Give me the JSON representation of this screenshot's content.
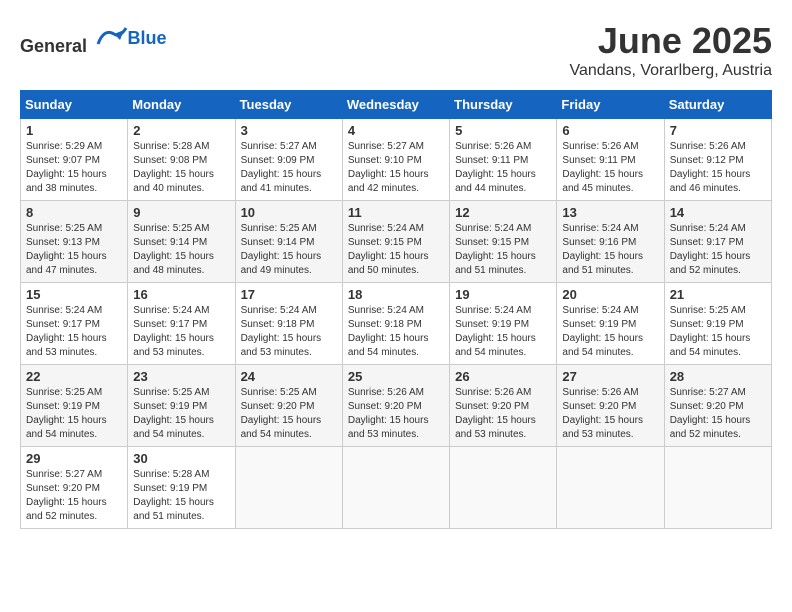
{
  "header": {
    "logo_general": "General",
    "logo_blue": "Blue",
    "month": "June 2025",
    "location": "Vandans, Vorarlberg, Austria"
  },
  "weekdays": [
    "Sunday",
    "Monday",
    "Tuesday",
    "Wednesday",
    "Thursday",
    "Friday",
    "Saturday"
  ],
  "weeks": [
    [
      {
        "day": "1",
        "sunrise": "Sunrise: 5:29 AM",
        "sunset": "Sunset: 9:07 PM",
        "daylight": "Daylight: 15 hours and 38 minutes."
      },
      {
        "day": "2",
        "sunrise": "Sunrise: 5:28 AM",
        "sunset": "Sunset: 9:08 PM",
        "daylight": "Daylight: 15 hours and 40 minutes."
      },
      {
        "day": "3",
        "sunrise": "Sunrise: 5:27 AM",
        "sunset": "Sunset: 9:09 PM",
        "daylight": "Daylight: 15 hours and 41 minutes."
      },
      {
        "day": "4",
        "sunrise": "Sunrise: 5:27 AM",
        "sunset": "Sunset: 9:10 PM",
        "daylight": "Daylight: 15 hours and 42 minutes."
      },
      {
        "day": "5",
        "sunrise": "Sunrise: 5:26 AM",
        "sunset": "Sunset: 9:11 PM",
        "daylight": "Daylight: 15 hours and 44 minutes."
      },
      {
        "day": "6",
        "sunrise": "Sunrise: 5:26 AM",
        "sunset": "Sunset: 9:11 PM",
        "daylight": "Daylight: 15 hours and 45 minutes."
      },
      {
        "day": "7",
        "sunrise": "Sunrise: 5:26 AM",
        "sunset": "Sunset: 9:12 PM",
        "daylight": "Daylight: 15 hours and 46 minutes."
      }
    ],
    [
      {
        "day": "8",
        "sunrise": "Sunrise: 5:25 AM",
        "sunset": "Sunset: 9:13 PM",
        "daylight": "Daylight: 15 hours and 47 minutes."
      },
      {
        "day": "9",
        "sunrise": "Sunrise: 5:25 AM",
        "sunset": "Sunset: 9:14 PM",
        "daylight": "Daylight: 15 hours and 48 minutes."
      },
      {
        "day": "10",
        "sunrise": "Sunrise: 5:25 AM",
        "sunset": "Sunset: 9:14 PM",
        "daylight": "Daylight: 15 hours and 49 minutes."
      },
      {
        "day": "11",
        "sunrise": "Sunrise: 5:24 AM",
        "sunset": "Sunset: 9:15 PM",
        "daylight": "Daylight: 15 hours and 50 minutes."
      },
      {
        "day": "12",
        "sunrise": "Sunrise: 5:24 AM",
        "sunset": "Sunset: 9:15 PM",
        "daylight": "Daylight: 15 hours and 51 minutes."
      },
      {
        "day": "13",
        "sunrise": "Sunrise: 5:24 AM",
        "sunset": "Sunset: 9:16 PM",
        "daylight": "Daylight: 15 hours and 51 minutes."
      },
      {
        "day": "14",
        "sunrise": "Sunrise: 5:24 AM",
        "sunset": "Sunset: 9:17 PM",
        "daylight": "Daylight: 15 hours and 52 minutes."
      }
    ],
    [
      {
        "day": "15",
        "sunrise": "Sunrise: 5:24 AM",
        "sunset": "Sunset: 9:17 PM",
        "daylight": "Daylight: 15 hours and 53 minutes."
      },
      {
        "day": "16",
        "sunrise": "Sunrise: 5:24 AM",
        "sunset": "Sunset: 9:17 PM",
        "daylight": "Daylight: 15 hours and 53 minutes."
      },
      {
        "day": "17",
        "sunrise": "Sunrise: 5:24 AM",
        "sunset": "Sunset: 9:18 PM",
        "daylight": "Daylight: 15 hours and 53 minutes."
      },
      {
        "day": "18",
        "sunrise": "Sunrise: 5:24 AM",
        "sunset": "Sunset: 9:18 PM",
        "daylight": "Daylight: 15 hours and 54 minutes."
      },
      {
        "day": "19",
        "sunrise": "Sunrise: 5:24 AM",
        "sunset": "Sunset: 9:19 PM",
        "daylight": "Daylight: 15 hours and 54 minutes."
      },
      {
        "day": "20",
        "sunrise": "Sunrise: 5:24 AM",
        "sunset": "Sunset: 9:19 PM",
        "daylight": "Daylight: 15 hours and 54 minutes."
      },
      {
        "day": "21",
        "sunrise": "Sunrise: 5:25 AM",
        "sunset": "Sunset: 9:19 PM",
        "daylight": "Daylight: 15 hours and 54 minutes."
      }
    ],
    [
      {
        "day": "22",
        "sunrise": "Sunrise: 5:25 AM",
        "sunset": "Sunset: 9:19 PM",
        "daylight": "Daylight: 15 hours and 54 minutes."
      },
      {
        "day": "23",
        "sunrise": "Sunrise: 5:25 AM",
        "sunset": "Sunset: 9:19 PM",
        "daylight": "Daylight: 15 hours and 54 minutes."
      },
      {
        "day": "24",
        "sunrise": "Sunrise: 5:25 AM",
        "sunset": "Sunset: 9:20 PM",
        "daylight": "Daylight: 15 hours and 54 minutes."
      },
      {
        "day": "25",
        "sunrise": "Sunrise: 5:26 AM",
        "sunset": "Sunset: 9:20 PM",
        "daylight": "Daylight: 15 hours and 53 minutes."
      },
      {
        "day": "26",
        "sunrise": "Sunrise: 5:26 AM",
        "sunset": "Sunset: 9:20 PM",
        "daylight": "Daylight: 15 hours and 53 minutes."
      },
      {
        "day": "27",
        "sunrise": "Sunrise: 5:26 AM",
        "sunset": "Sunset: 9:20 PM",
        "daylight": "Daylight: 15 hours and 53 minutes."
      },
      {
        "day": "28",
        "sunrise": "Sunrise: 5:27 AM",
        "sunset": "Sunset: 9:20 PM",
        "daylight": "Daylight: 15 hours and 52 minutes."
      }
    ],
    [
      {
        "day": "29",
        "sunrise": "Sunrise: 5:27 AM",
        "sunset": "Sunset: 9:20 PM",
        "daylight": "Daylight: 15 hours and 52 minutes."
      },
      {
        "day": "30",
        "sunrise": "Sunrise: 5:28 AM",
        "sunset": "Sunset: 9:19 PM",
        "daylight": "Daylight: 15 hours and 51 minutes."
      },
      null,
      null,
      null,
      null,
      null
    ]
  ]
}
